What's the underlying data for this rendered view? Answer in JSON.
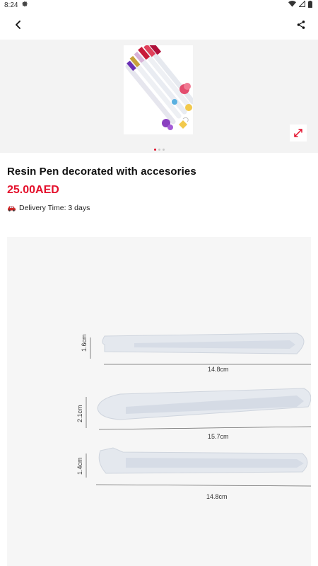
{
  "status_bar": {
    "time": "8:24"
  },
  "product": {
    "title": "Resin Pen decorated with accesories",
    "price": "25.00AED",
    "delivery_label": "Delivery Time: 3 days"
  },
  "gallery": {
    "image_count": 3,
    "active_index": 0
  },
  "detail_image": {
    "measurements": [
      {
        "height": "1.6cm",
        "length": "14.8cm"
      },
      {
        "height": "2.1cm",
        "length": "15.7cm"
      },
      {
        "height": "1.4cm",
        "length": "14.8cm"
      }
    ]
  },
  "icons": {
    "back": "arrow-back-icon",
    "share": "share-icon",
    "expand": "expand-icon",
    "delivery": "car-icon"
  },
  "colors": {
    "accent": "#e4102c",
    "gallery_bg": "#f3f3f3"
  }
}
